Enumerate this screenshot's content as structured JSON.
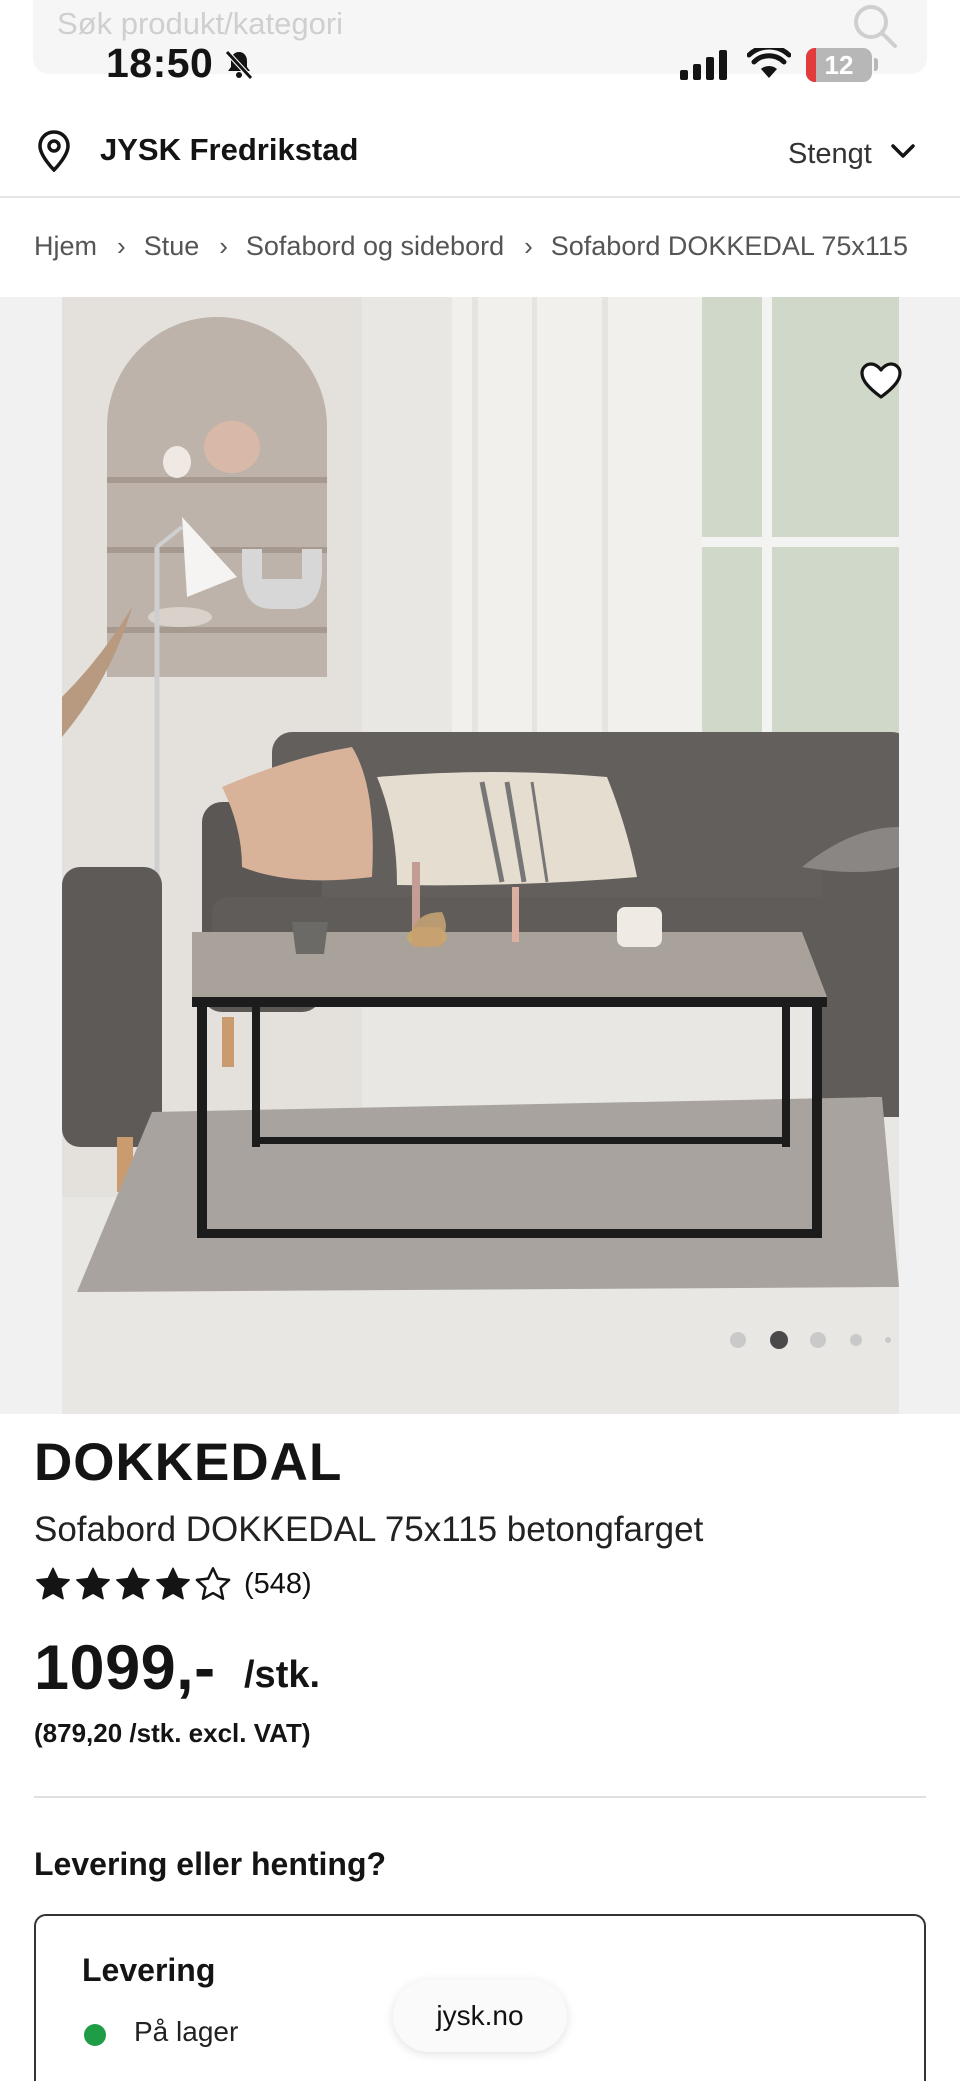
{
  "status_bar": {
    "time": "18:50",
    "battery": "12",
    "battery_color": "#e23b3b"
  },
  "search": {
    "placeholder": "Søk produkt/kategori"
  },
  "store": {
    "name": "JYSK Fredrikstad",
    "status": "Stengt"
  },
  "breadcrumb": [
    "Hjem",
    "Stue",
    "Sofabord og sidebord",
    "Sofabord DOKKEDAL 75x115"
  ],
  "gallery": {
    "dot_count": 5,
    "active_dot": 1
  },
  "product": {
    "brand": "DOKKEDAL",
    "title": "Sofabord DOKKEDAL 75x115 betongfarget",
    "rating": 4,
    "rating_max": 5,
    "review_count": "(548)",
    "price": "1099,-",
    "unit": "/stk.",
    "price_ex_vat": "(879,20 /stk. excl. VAT)"
  },
  "delivery": {
    "question": "Levering eller henting?",
    "option_title": "Levering",
    "stock_status": "På lager",
    "stock_color": "#1f9d46"
  },
  "browser": {
    "domain": "jysk.no"
  }
}
